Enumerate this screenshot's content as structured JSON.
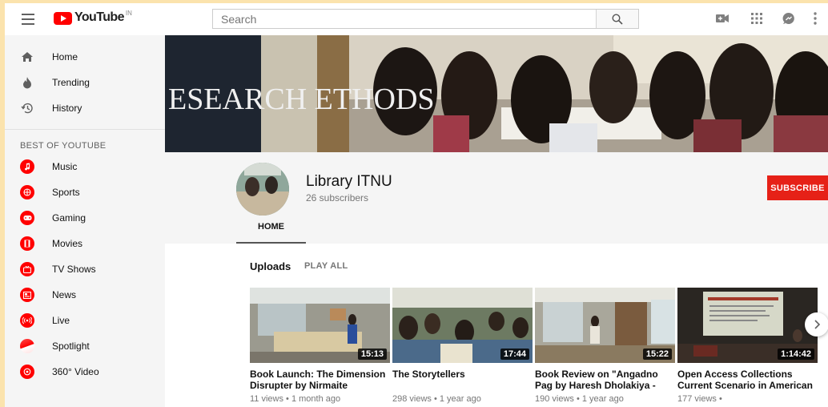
{
  "topbar": {
    "logo_text": "YouTube",
    "logo_country": "IN",
    "search_placeholder": "Search"
  },
  "sidebar": {
    "main_items": [
      {
        "label": "Home",
        "icon": "home-icon"
      },
      {
        "label": "Trending",
        "icon": "flame-icon"
      },
      {
        "label": "History",
        "icon": "history-icon"
      }
    ],
    "section_title": "BEST OF YOUTUBE",
    "best_items": [
      {
        "label": "Music",
        "icon": "music-icon"
      },
      {
        "label": "Sports",
        "icon": "sports-icon"
      },
      {
        "label": "Gaming",
        "icon": "gaming-icon"
      },
      {
        "label": "Movies",
        "icon": "movies-icon"
      },
      {
        "label": "TV Shows",
        "icon": "tv-icon"
      },
      {
        "label": "News",
        "icon": "news-icon"
      },
      {
        "label": "Live",
        "icon": "live-icon"
      },
      {
        "label": "Spotlight",
        "icon": "spotlight-icon"
      },
      {
        "label": "360° Video",
        "icon": "360-video-icon"
      }
    ]
  },
  "channel": {
    "banner_text": "ESEARCH ETHODS",
    "name": "Library ITNU",
    "subscribers": "26 subscribers",
    "subscribe_label": "SUBSCRIBE",
    "tab_home": "HOME"
  },
  "uploads": {
    "title": "Uploads",
    "play_all": "PLAY ALL",
    "videos": [
      {
        "title": "Book Launch: The Dimension Disrupter by Nirmaite",
        "meta": "11 views • 1 month ago",
        "duration": "15:13"
      },
      {
        "title": "The Storytellers",
        "meta": "298 views • 1 year ago",
        "duration": "17:44"
      },
      {
        "title": "Book Review on \"Angadno Pag by Haresh Dholakiya -",
        "meta": "190 views • 1 year ago",
        "duration": "15:22"
      },
      {
        "title": "Open Access Collections Current Scenario in American",
        "meta": "177 views •",
        "duration": "1:14:42"
      }
    ]
  },
  "colors": {
    "brand_red": "#ff0000",
    "subscribe_red": "#e62117",
    "outer_background": "#fbe3ad"
  }
}
